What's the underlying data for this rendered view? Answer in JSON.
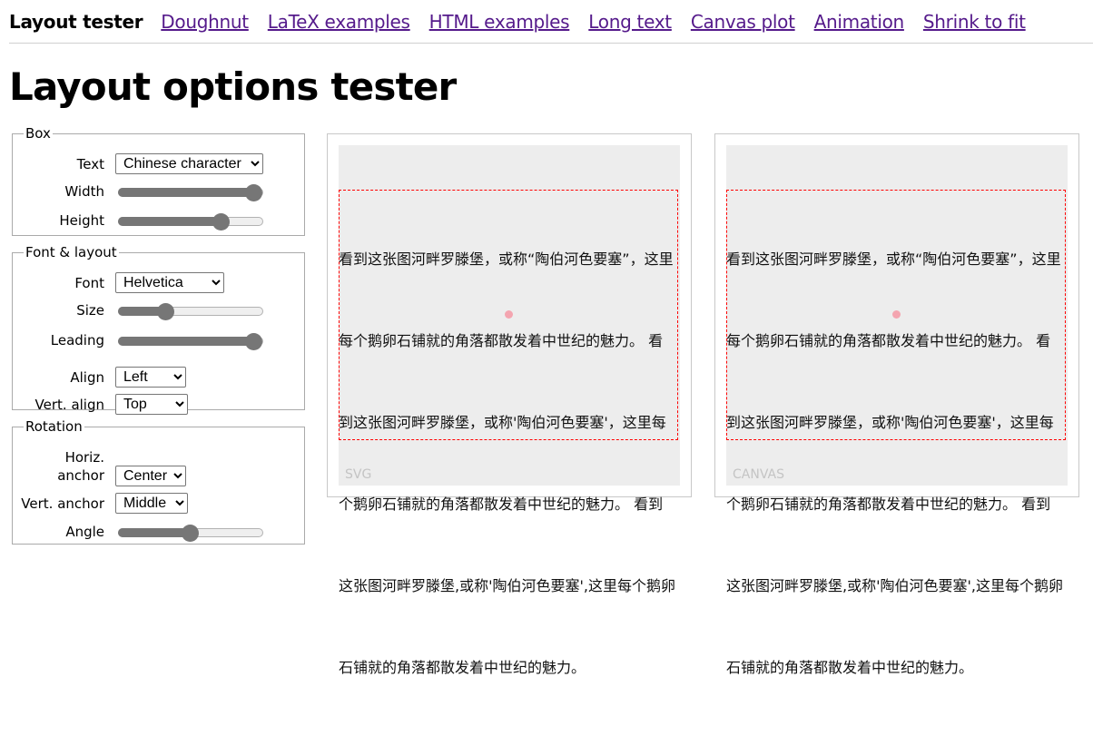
{
  "nav": {
    "brand": "Layout tester",
    "links": [
      "Doughnut",
      "LaTeX examples",
      "HTML examples",
      "Long text",
      "Canvas plot",
      "Animation",
      "Shrink to fit"
    ]
  },
  "page_title": "Layout options tester",
  "box": {
    "legend": "Box",
    "text_label": "Text",
    "text_value": "Chinese character",
    "width_label": "Width",
    "width_value": 1.0,
    "height_label": "Height",
    "height_value": 0.72
  },
  "font_layout": {
    "legend": "Font & layout",
    "font_label": "Font",
    "font_value": "Helvetica",
    "size_label": "Size",
    "size_value": 0.33,
    "leading_label": "Leading",
    "leading_value": 1.0,
    "align_label": "Align",
    "align_value": "Left",
    "valign_label": "Vert. align",
    "valign_value": "Top"
  },
  "rotation": {
    "legend": "Rotation",
    "hanchor_label_1": "Horiz.",
    "hanchor_label_2": "anchor",
    "hanchor_value": "Center",
    "vanchor_label": "Vert. anchor",
    "vanchor_value": "Middle",
    "angle_label": "Angle",
    "angle_value": 0.5
  },
  "preview": {
    "lines": [
      "看到这张图河畔罗滕堡，或称“陶伯河色要塞”，这里",
      "每个鹅卵石铺就的角落都散发着中世纪的魅力。 看",
      "到这张图河畔罗滕堡，或称'陶伯河色要塞'，这里每",
      "个鹅卵石铺就的角落都散发着中世纪的魅力。 看到",
      "这张图河畔罗滕堡,或称'陶伯河色要塞',这里每个鹅卵",
      "石铺就的角落都散发着中世纪的魅力。"
    ],
    "svg_label": "SVG",
    "canvas_label": "CANVAS"
  }
}
